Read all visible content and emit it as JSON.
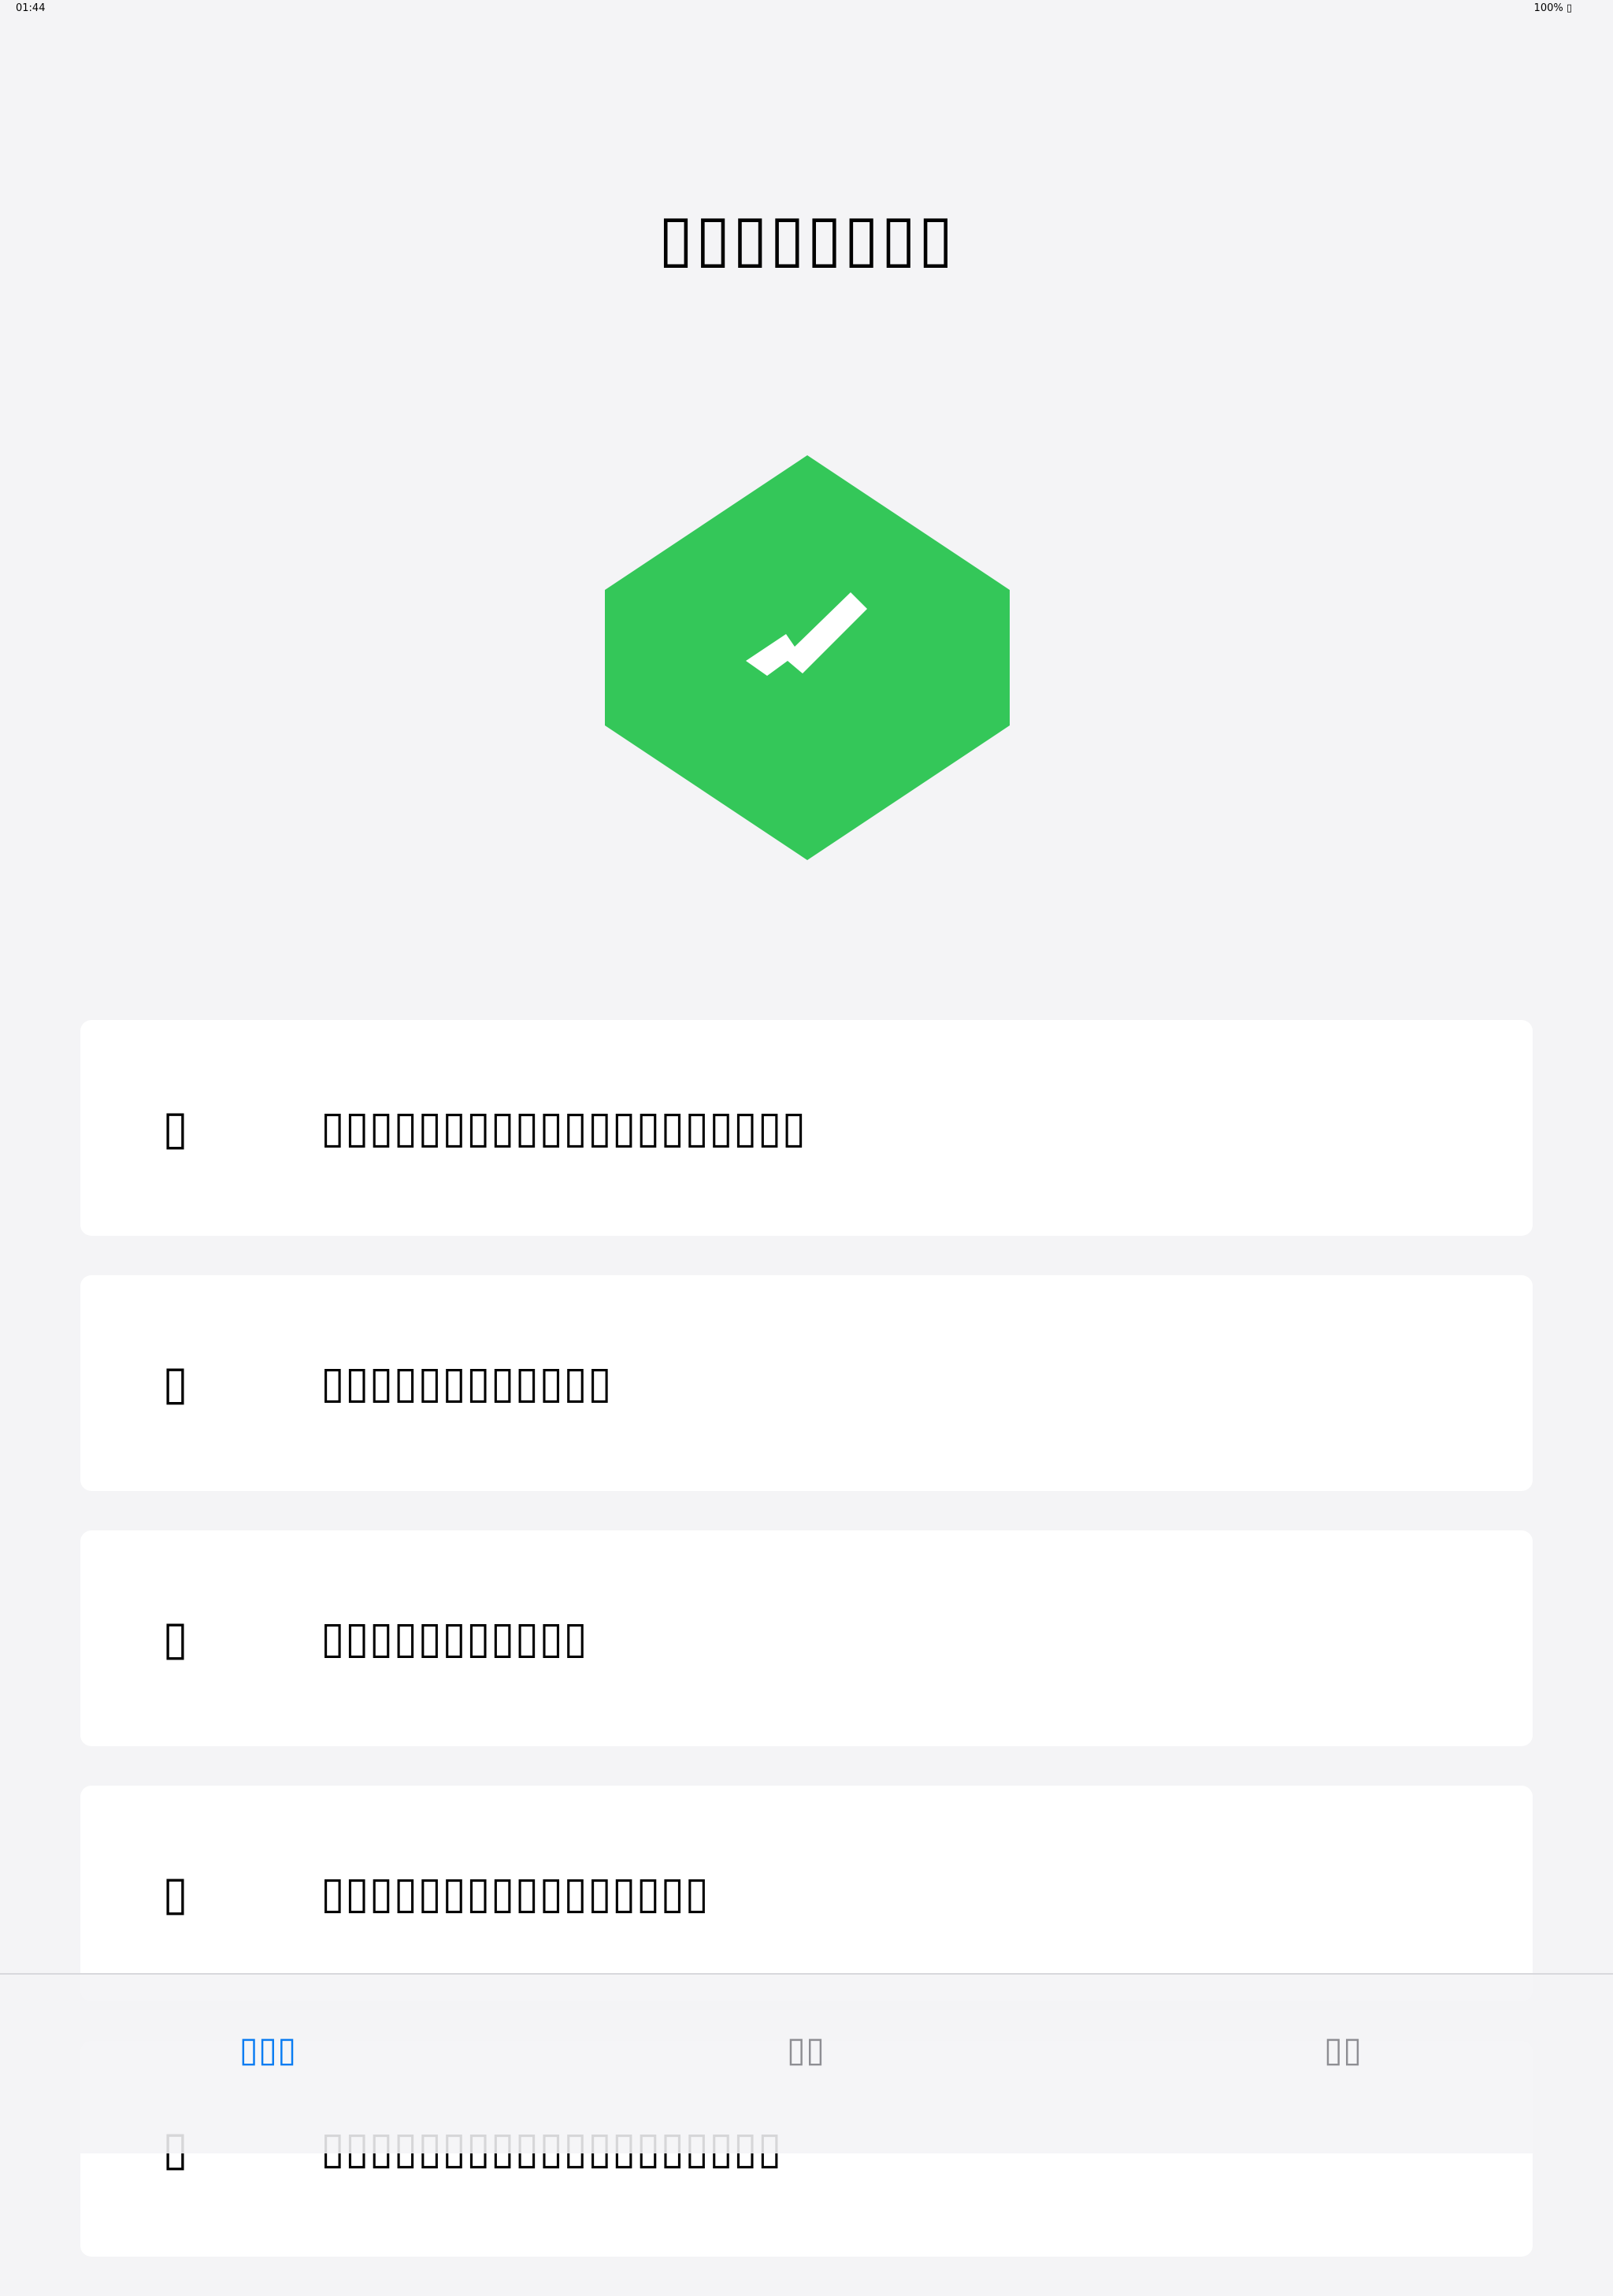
{
  "status_bar": {
    "time": "01:44",
    "battery": "100% ▯"
  },
  "header": {
    "title": "▯▯▯▯▯▯▯▯"
  },
  "badge": {
    "icon": "checkmark-hexagon-icon",
    "color": "#34c759"
  },
  "cards": [
    {
      "icon": "▯",
      "text": "▯▯▯▯▯▯▯▯▯▯▯▯▯▯▯▯▯▯▯▯"
    },
    {
      "icon": "▯",
      "text": "▯▯▯▯▯▯▯▯▯▯▯▯"
    },
    {
      "icon": "▯",
      "text": "▯▯▯▯▯▯▯▯▯▯▯"
    },
    {
      "icon": "▯",
      "text": "▯▯▯▯▯▯▯▯▯▯▯▯▯▯▯▯"
    },
    {
      "icon": "▯",
      "text": "▯▯▯▯▯▯▯▯▯▯▯▯▯▯▯▯▯▯▯"
    }
  ],
  "tab_bar": {
    "tabs": [
      {
        "label": "▯▯▯",
        "active": true
      },
      {
        "label": "▯▯",
        "active": false
      },
      {
        "label": "▯▯",
        "active": false
      }
    ],
    "active_color": "#0a7cf2",
    "inactive_color": "#8e8e93"
  }
}
